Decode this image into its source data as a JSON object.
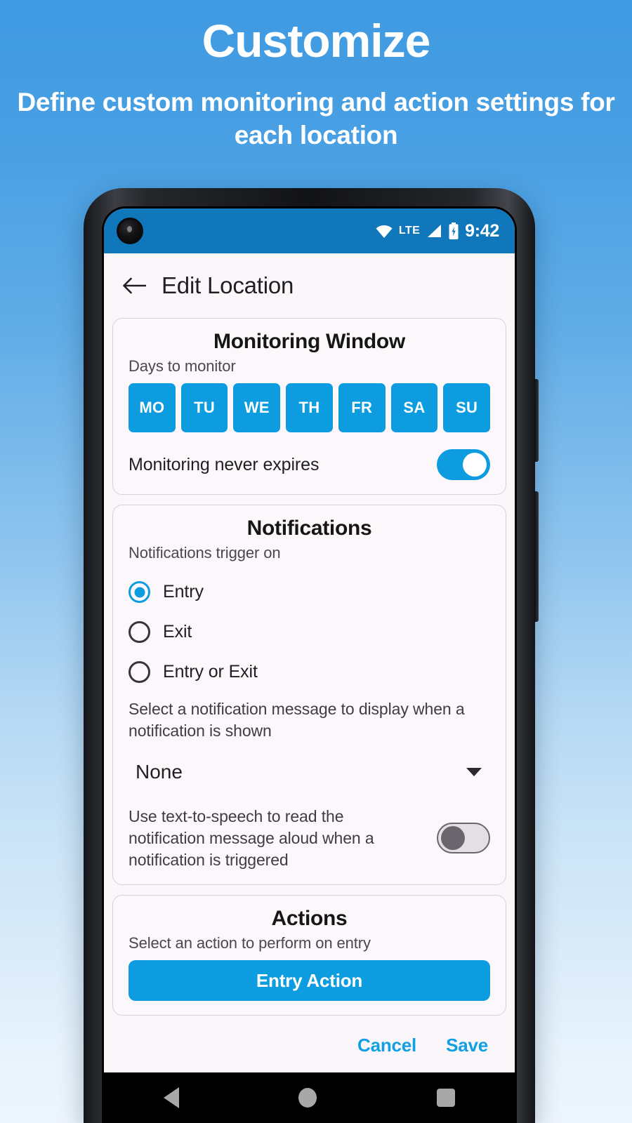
{
  "promo": {
    "title": "Customize",
    "subtitle": "Define custom monitoring and action settings for each location"
  },
  "statusbar": {
    "network_label": "LTE",
    "clock": "9:42",
    "icons": [
      "wifi-icon",
      "signal-icon",
      "battery-icon"
    ]
  },
  "appbar": {
    "back_label": "back-arrow-icon",
    "title": "Edit Location"
  },
  "monitoring_card": {
    "title": "Monitoring Window",
    "days_label": "Days to monitor",
    "days": [
      {
        "label": "MO",
        "selected": true
      },
      {
        "label": "TU",
        "selected": true
      },
      {
        "label": "WE",
        "selected": true
      },
      {
        "label": "TH",
        "selected": true
      },
      {
        "label": "FR",
        "selected": true
      },
      {
        "label": "SA",
        "selected": true
      },
      {
        "label": "SU",
        "selected": true
      }
    ],
    "never_expires_label": "Monitoring never expires",
    "never_expires_on": true
  },
  "notifications_card": {
    "title": "Notifications",
    "trigger_label": "Notifications trigger on",
    "options": [
      {
        "label": "Entry",
        "selected": true
      },
      {
        "label": "Exit",
        "selected": false
      },
      {
        "label": "Entry or Exit",
        "selected": false
      }
    ],
    "message_hint": "Select a notification message to display when a notification is shown",
    "message_value": "None",
    "tts_label": "Use text-to-speech to read the notification message aloud when a notification is triggered",
    "tts_on": false
  },
  "actions_card": {
    "title": "Actions",
    "hint": "Select an action to perform on entry",
    "entry_action_label": "Entry Action"
  },
  "bottombar": {
    "cancel_label": "Cancel",
    "save_label": "Save"
  },
  "navbar": {
    "back": "nav-back-icon",
    "home": "nav-home-icon",
    "recents": "nav-recents-icon"
  },
  "colors": {
    "accent": "#0d9ce0",
    "statusbar": "#1177bb",
    "surface": "#faf6f9",
    "bg_top": "#3f9ae2",
    "bg_bottom": "#eef6fd"
  }
}
